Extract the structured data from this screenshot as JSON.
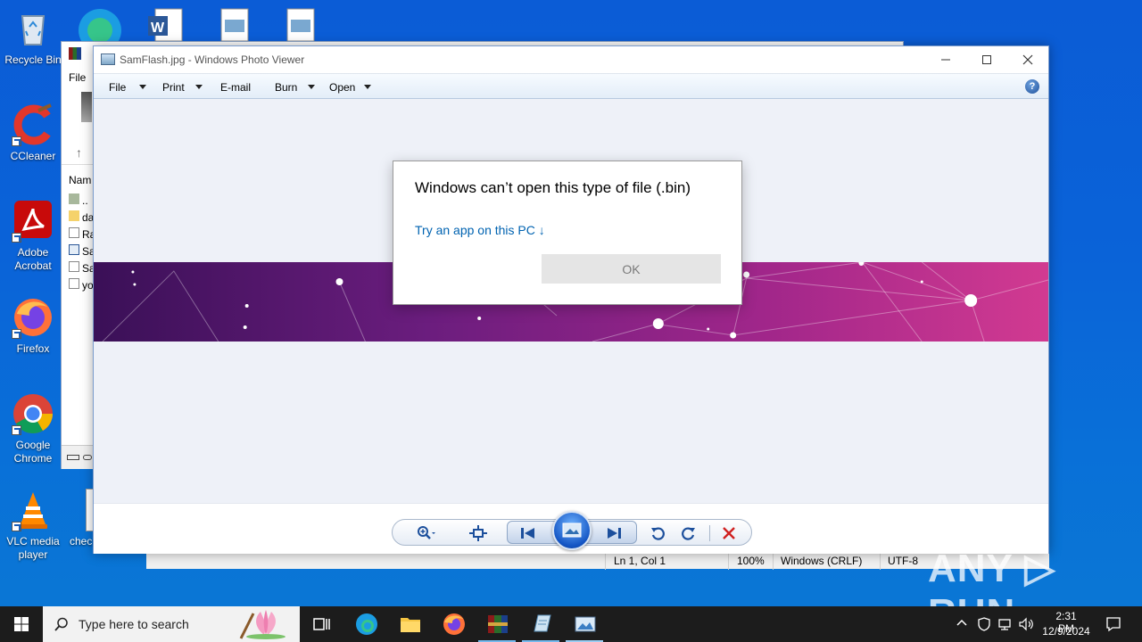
{
  "desktop": {
    "icons": [
      {
        "label": "Recycle Bin"
      },
      {
        "label": "CCleaner"
      },
      {
        "label": "Adobe Acrobat"
      },
      {
        "label": "Firefox"
      },
      {
        "label": "Google Chrome"
      },
      {
        "label": "VLC media player"
      },
      {
        "label": "chec"
      }
    ]
  },
  "bg_window": {
    "menu_file": "File",
    "column_name": "Nam",
    "rows": [
      "..",
      "da",
      "Ra",
      "Sa",
      "Sa",
      "yo"
    ]
  },
  "notepad_status": {
    "position": "Ln 1, Col 1",
    "zoom": "100%",
    "line_ending": "Windows (CRLF)",
    "encoding": "UTF-8"
  },
  "viewer": {
    "title": "SamFlash.jpg - Windows Photo Viewer",
    "menu": {
      "file": "File",
      "print": "Print",
      "email": "E-mail",
      "burn": "Burn",
      "open": "Open"
    },
    "help": "?"
  },
  "dialog": {
    "heading": "Windows can’t open this type of file (.bin)",
    "link": "Try an app on this PC ↓",
    "ok": "OK"
  },
  "taskbar": {
    "search_placeholder": "Type here to search",
    "time": "2:31 PM",
    "date": "12/9/2024"
  },
  "watermark": "ANY ▷ RUN",
  "colors": {
    "link": "#0063b1",
    "desktop": "#0a63d8",
    "taskbar": "#1c1c1c"
  }
}
